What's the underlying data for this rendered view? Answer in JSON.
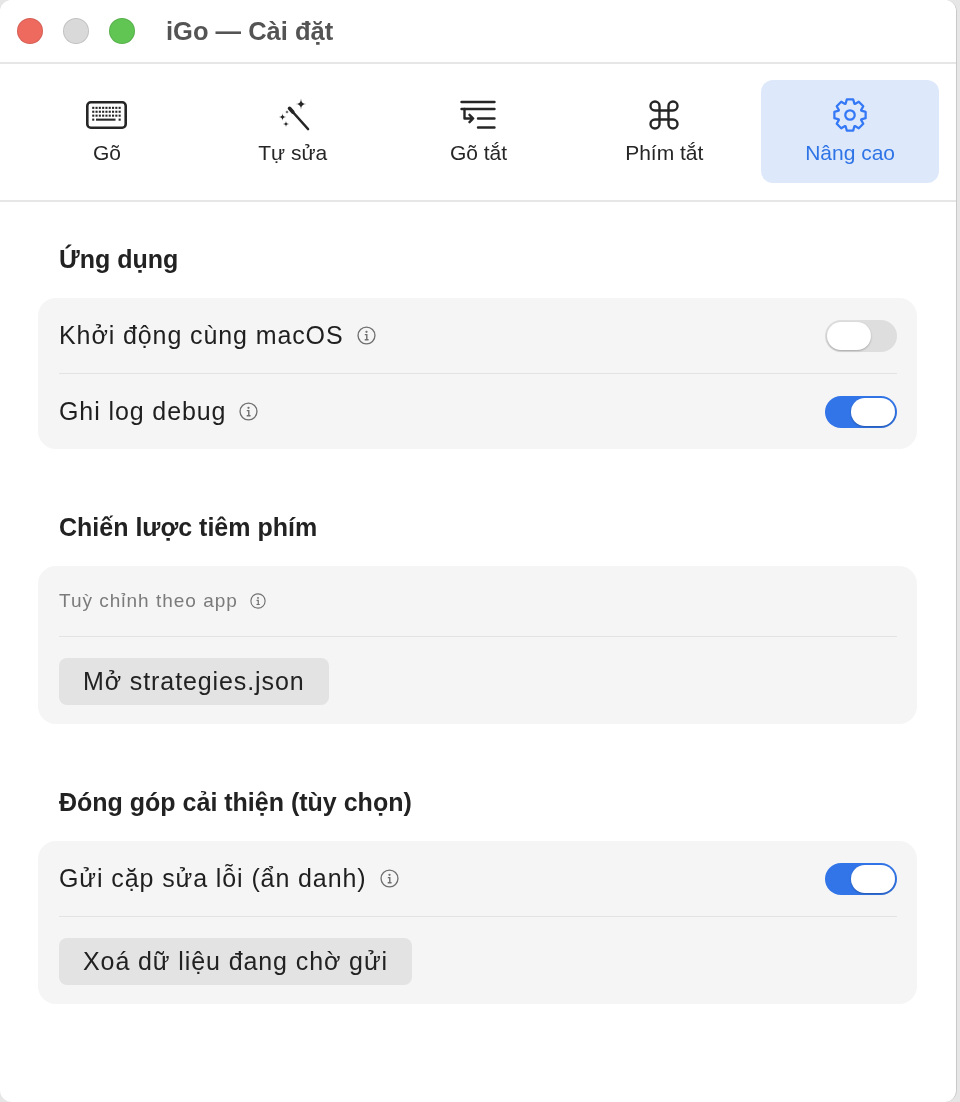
{
  "window": {
    "title": "iGo — Cài đặt",
    "controls": [
      {
        "kind": "close",
        "disabled": false
      },
      {
        "kind": "minimize",
        "disabled": true
      },
      {
        "kind": "zoom",
        "disabled": false
      }
    ]
  },
  "tabs": [
    {
      "label": "Gõ",
      "selected": false
    },
    {
      "label": "Tự sửa",
      "selected": false
    },
    {
      "label": "Gõ tắt",
      "selected": false
    },
    {
      "label": "Phím tắt",
      "selected": false
    },
    {
      "label": "Nâng cao",
      "selected": true
    }
  ],
  "sections": [
    {
      "heading": "Ứng dụng",
      "rows": [
        {
          "kind": "toggle",
          "label": "Khởi động cùng macOS",
          "info": true,
          "on": false
        },
        {
          "kind": "toggle",
          "label": "Ghi log debug",
          "info": true,
          "on": true
        }
      ]
    },
    {
      "heading": "Chiến lược tiêm phím",
      "rows": [
        {
          "kind": "note",
          "label": "Tuỳ chỉnh theo app",
          "info": true
        },
        {
          "kind": "button",
          "label": "Mở strategies.json"
        }
      ]
    },
    {
      "heading": "Đóng góp cải thiện (tùy chọn)",
      "rows": [
        {
          "kind": "toggle",
          "label": "Gửi cặp sửa lỗi (ẩn danh)",
          "info": true,
          "on": true
        },
        {
          "kind": "button",
          "label": "Xoá dữ liệu đang chờ gửi"
        }
      ]
    }
  ]
}
